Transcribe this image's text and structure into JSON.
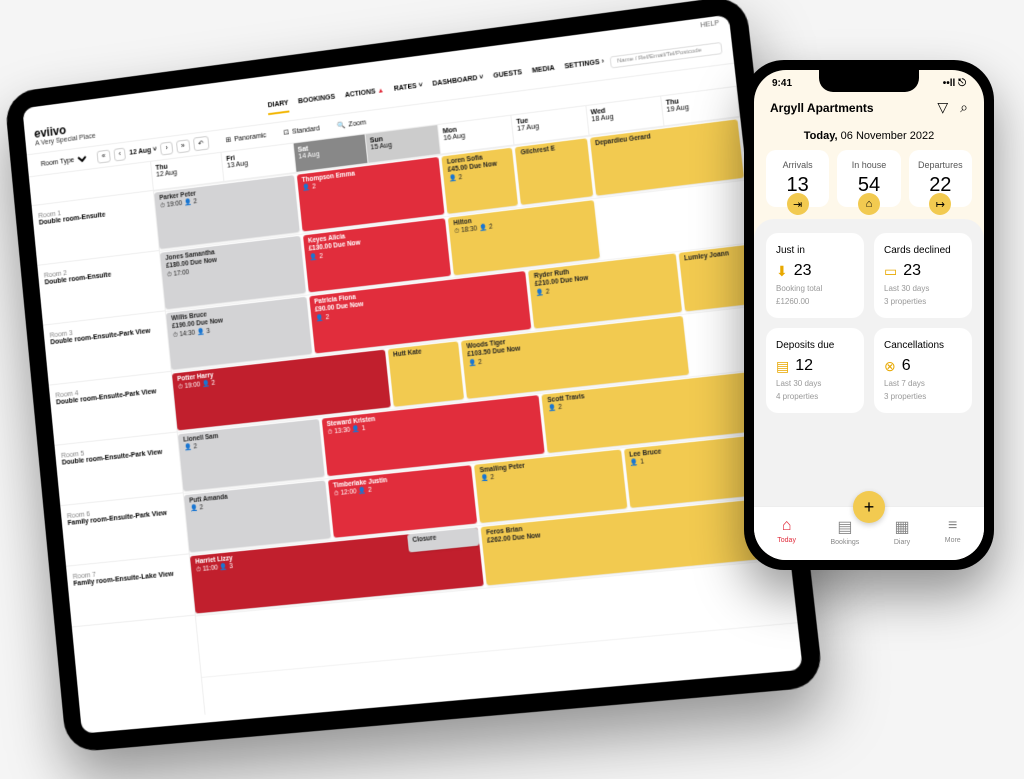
{
  "tablet": {
    "brand": "eviivo",
    "property": "A Very Special Place",
    "help": "HELP",
    "nav": [
      "DIARY",
      "BOOKINGS",
      "ACTIONS",
      "RATES",
      "DASHBOARD",
      "GUESTS",
      "MEDIA",
      "SETTINGS"
    ],
    "nav_active": "DIARY",
    "action_alert": "▲",
    "search_placeholder": "Name / Ref/Email/Tel/Postcode",
    "room_type": "Room Type",
    "current_date": "12 Aug",
    "view": {
      "panoramic": "Panoramic",
      "standard": "Standard",
      "zoom": "Zoom"
    },
    "days": [
      {
        "name": "Thu",
        "date": "12 Aug"
      },
      {
        "name": "Fri",
        "date": "13 Aug"
      },
      {
        "name": "Sat",
        "date": "14 Aug",
        "wknd": true
      },
      {
        "name": "Sun",
        "date": "15 Aug",
        "half": true
      },
      {
        "name": "Mon",
        "date": "16 Aug"
      },
      {
        "name": "Tue",
        "date": "17 Aug"
      },
      {
        "name": "Wed",
        "date": "18 Aug"
      },
      {
        "name": "Thu",
        "date": "19 Aug"
      }
    ],
    "rooms": [
      {
        "name": "Room 1",
        "desc": "Double room-Ensuite"
      },
      {
        "name": "Room 2",
        "desc": "Double room-Ensuite"
      },
      {
        "name": "Room 3",
        "desc": "Double room-Ensuite-Park View"
      },
      {
        "name": "Room 4",
        "desc": "Double room-Ensuite-Park View"
      },
      {
        "name": "Room 5",
        "desc": "Double room-Ensuite-Park View"
      },
      {
        "name": "Room 6",
        "desc": "Family room-Ensuite-Park View"
      },
      {
        "name": "Room 7",
        "desc": "Family room-Ensuite-Lake View"
      }
    ],
    "bookings": [
      {
        "row": 0,
        "start": 0,
        "span": 2,
        "cls": "gray",
        "name": "Parker Peter",
        "time": "19:00",
        "pax": "2"
      },
      {
        "row": 0,
        "start": 2,
        "span": 2,
        "cls": "red",
        "name": "Thompson Emma",
        "pax": "2"
      },
      {
        "row": 0,
        "start": 4,
        "span": 1,
        "cls": "yellow",
        "name": "Loren Sofia",
        "due": "£45.00 Due Now",
        "pax": "2"
      },
      {
        "row": 0,
        "start": 5,
        "span": 1,
        "cls": "yellow",
        "name": "Gilchrest E"
      },
      {
        "row": 0,
        "start": 6,
        "span": 2,
        "cls": "yellow",
        "name": "Depardieu Gerard"
      },
      {
        "row": 1,
        "start": 0,
        "span": 2,
        "cls": "gray",
        "name": "Jones Samantha",
        "due": "£180.00 Due Now",
        "time": "17:00"
      },
      {
        "row": 1,
        "start": 2,
        "span": 2,
        "cls": "red",
        "name": "Keyes Alicia",
        "due": "£130.00 Due Now",
        "pax": "2"
      },
      {
        "row": 1,
        "start": 4,
        "span": 2,
        "cls": "yellow",
        "name": "Hilton",
        "time": "18:30",
        "pax": "2"
      },
      {
        "row": 2,
        "start": 0,
        "span": 2,
        "cls": "gray",
        "name": "Willis Bruce",
        "due": "£190.00 Due Now",
        "time": "14:30",
        "pax": "3"
      },
      {
        "row": 2,
        "start": 2,
        "span": 3,
        "cls": "red",
        "name": "Patricia Fiona",
        "due": "£90.00 Due Now",
        "pax": "2"
      },
      {
        "row": 2,
        "start": 5,
        "span": 2,
        "cls": "yellow",
        "name": "Ryder Ruth",
        "due": "£210.00 Due Now",
        "pax": "2"
      },
      {
        "row": 2,
        "start": 7,
        "span": 1,
        "cls": "yellow",
        "name": "Lumley Joann"
      },
      {
        "row": 3,
        "start": 0,
        "span": 3,
        "cls": "darkred",
        "name": "Potter Harry",
        "time": "19:00",
        "pax": "2"
      },
      {
        "row": 3,
        "start": 3,
        "span": 1,
        "cls": "yellow",
        "name": "Hutt Kate"
      },
      {
        "row": 3,
        "start": 4,
        "span": 3,
        "cls": "yellow",
        "name": "Woods Tiger",
        "due": "£103.50 Due Now",
        "pax": "2"
      },
      {
        "row": 4,
        "start": 0,
        "span": 2,
        "cls": "gray",
        "name": "Lionell Sam",
        "pax": "2"
      },
      {
        "row": 4,
        "start": 2,
        "span": 3,
        "cls": "red",
        "name": "Steward Kristen",
        "time": "13:30",
        "pax": "1",
        "extra": "2"
      },
      {
        "row": 4,
        "start": 5,
        "span": 3,
        "cls": "yellow",
        "name": "Scott Travis",
        "pax": "2"
      },
      {
        "row": 5,
        "start": 0,
        "span": 2,
        "cls": "gray",
        "name": "Putt Amanda",
        "pax": "2"
      },
      {
        "row": 5,
        "start": 2,
        "span": 2,
        "cls": "red",
        "name": "Timberlake Justin",
        "time": "12:00",
        "pax": "2"
      },
      {
        "row": 5,
        "start": 4,
        "span": 2,
        "cls": "yellow",
        "name": "Smalling Peter",
        "pax": "2"
      },
      {
        "row": 5,
        "start": 6,
        "span": 2,
        "cls": "yellow",
        "name": "Lee Bruce",
        "pax": "1"
      },
      {
        "row": 6,
        "start": 0,
        "span": 4,
        "cls": "darkred",
        "name": "Harriet Lizzy",
        "time": "11:00",
        "pax": "3"
      },
      {
        "row": 6,
        "start": 3,
        "span": 1,
        "cls": "gray",
        "name": "Closure",
        "small": true
      },
      {
        "row": 6,
        "start": 4,
        "span": 4,
        "cls": "yellow",
        "name": "Feros Brian",
        "due": "£262.00 Due Now"
      }
    ]
  },
  "phone": {
    "time": "9:41",
    "signal": "••ll ⎋",
    "property": "Argyll Apartments",
    "today_label": "Today,",
    "today_date": "06 November 2022",
    "kpis": [
      {
        "label": "Arrivals",
        "value": "13",
        "icon": "⇥"
      },
      {
        "label": "In house",
        "value": "54",
        "icon": "⌂"
      },
      {
        "label": "Departures",
        "value": "22",
        "icon": "↦"
      }
    ],
    "cards": [
      {
        "title": "Just in",
        "value": "23",
        "sub1": "Booking total",
        "sub2": "£1260.00",
        "icon": "⬇"
      },
      {
        "title": "Cards declined",
        "value": "23",
        "sub1": "Last 30 days",
        "sub2": "3 properties",
        "icon": "▭"
      },
      {
        "title": "Deposits due",
        "value": "12",
        "sub1": "Last 30 days",
        "sub2": "4 properties",
        "icon": "▤"
      },
      {
        "title": "Cancellations",
        "value": "6",
        "sub1": "Last 7 days",
        "sub2": "3 properties",
        "icon": "⊗"
      }
    ],
    "tabs": [
      {
        "label": "Today",
        "icon": "⌂",
        "active": true
      },
      {
        "label": "Bookings",
        "icon": "▤"
      },
      {
        "label": "Diary",
        "icon": "▦"
      },
      {
        "label": "More",
        "icon": "≡"
      }
    ]
  }
}
